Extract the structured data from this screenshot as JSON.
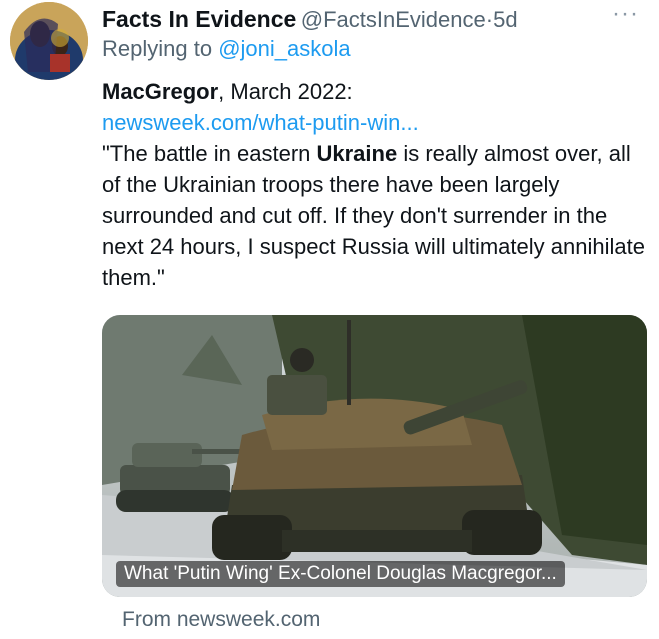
{
  "author": {
    "name": "Facts In Evidence",
    "handle": "@FactsInEvidence",
    "separator": "·",
    "time": "5d",
    "avatar_icon": "religious-icon-avatar"
  },
  "more_menu_glyph": "···",
  "reply": {
    "prefix": "Replying to ",
    "handle": "@joni_askola"
  },
  "tweet": {
    "lead_bold": "MacGregor",
    "lead_rest": ", March 2022:",
    "link": "newsweek.com/what-putin-win...",
    "quote_part1": "\"The battle in eastern ",
    "quote_bold": "Ukraine",
    "quote_part2": " is really almost over, all of the Ukrainian troops there have been largely surrounded and cut off. If they don't surrender in the next 24 hours, I suspect Russia will ultimately annihilate them.\""
  },
  "card": {
    "title": "What 'Putin Wing' Ex-Colonel Douglas Macgregor...",
    "image_icon": "tank-photo"
  },
  "source": "From newsweek.com",
  "colors": {
    "link": "#1d9bf0",
    "secondary_text": "#536471",
    "primary_text": "#0f1419"
  }
}
